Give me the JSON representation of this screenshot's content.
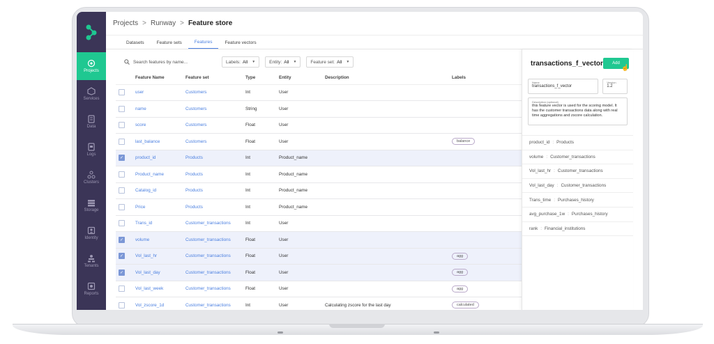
{
  "breadcrumb": {
    "root": "Projects",
    "project": "Runway",
    "current": "Feature store",
    "sep": ">"
  },
  "tabs": [
    "Datasets",
    "Feature sets",
    "Features",
    "Feature vectors"
  ],
  "sidebar": [
    "Projects",
    "Services",
    "Data",
    "Logs",
    "Clusters",
    "Storage",
    "Identity",
    "Tenants",
    "Reports"
  ],
  "filters": {
    "search_placeholder": "Search features by name...",
    "labels": {
      "label": "Labels:",
      "value": "All"
    },
    "entity": {
      "label": "Entity:",
      "value": "All"
    },
    "feature_set": {
      "label": "Feature set:",
      "value": "All"
    }
  },
  "table": {
    "headers": [
      "Feature Name",
      "Feature set",
      "Type",
      "Entity",
      "Description",
      "Labels"
    ],
    "rows": [
      {
        "name": "user",
        "set": "Customers",
        "type": "Int",
        "entity": "User",
        "label": ""
      },
      {
        "name": "name",
        "set": "Customers",
        "type": "String",
        "entity": "User",
        "label": ""
      },
      {
        "name": "score",
        "set": "Customers",
        "type": "Float",
        "entity": "User",
        "label": ""
      },
      {
        "name": "last_balance",
        "set": "Customers",
        "type": "Float",
        "entity": "User",
        "label": "balance"
      },
      {
        "name": "product_id",
        "set": "Products",
        "type": "Int",
        "entity": "Product_name",
        "label": ""
      },
      {
        "name": "Product_name",
        "set": "Products",
        "type": "Int",
        "entity": "Product_name",
        "label": ""
      },
      {
        "name": "Catalog_id",
        "set": "Products",
        "type": "Int",
        "entity": "Product_name",
        "label": ""
      },
      {
        "name": "Price",
        "set": "Products",
        "type": "Int",
        "entity": "Product_name",
        "label": ""
      },
      {
        "name": "Trans_id",
        "set": "Customer_transactions",
        "type": "Int",
        "entity": "User",
        "label": ""
      },
      {
        "name": "volume",
        "set": "Customer_transactions",
        "type": "Float",
        "entity": "User",
        "label": ""
      },
      {
        "name": "Vol_last_hr",
        "set": "Customer_transactions",
        "type": "Float",
        "entity": "User",
        "label": "agg"
      },
      {
        "name": "Vol_last_day",
        "set": "Customer_transactions",
        "type": "Float",
        "entity": "User",
        "label": "agg"
      },
      {
        "name": "Vol_last_week",
        "set": "Customer_transactions",
        "type": "Float",
        "entity": "User",
        "label": "agg"
      },
      {
        "name": "Vol_zscore_1d",
        "set": "Customer_transactions",
        "type": "Int",
        "entity": "User",
        "label": "calculated",
        "description": "Calculating zscore for the last day"
      }
    ]
  },
  "panel": {
    "title": "transactions_f_vector",
    "add_label": "Add",
    "name_label": "Name",
    "name_value": "transactions_f_vector",
    "version_label": "Version",
    "version_value": "1.2",
    "desc_label": "Description (optional)",
    "desc_value": "this feature vector is used for the scoring model. It has the customer transactions data along with real time aggregations and zscore calculation.",
    "items": [
      {
        "feature": "product_id",
        "set": "Products"
      },
      {
        "feature": "volume",
        "set": "Customer_transactions"
      },
      {
        "feature": "Vol_last_hr",
        "set": "Customer_transactions"
      },
      {
        "feature": "Vol_last_day",
        "set": "Customer_transactions"
      },
      {
        "feature": "Trans_time",
        "set": "Purchases_history"
      },
      {
        "feature": "avg_purchase_1w",
        "set": "Purchases_history"
      },
      {
        "feature": "rank",
        "set": "Financial_institutions"
      }
    ],
    "item_sep": ":"
  },
  "colors": {
    "accent": "#1fc891",
    "sidebar": "#3b3557",
    "link": "#4a7fe0"
  }
}
